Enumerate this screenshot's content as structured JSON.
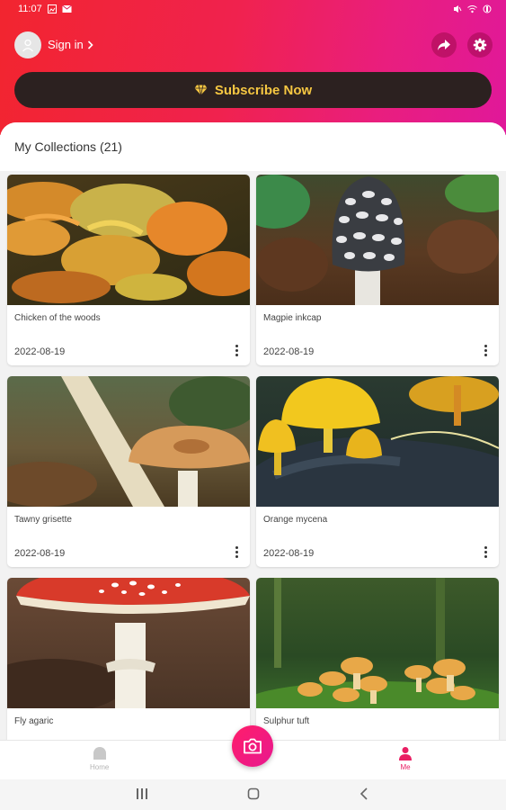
{
  "status_bar": {
    "time": "11:07"
  },
  "header": {
    "sign_in_label": "Sign in",
    "subscribe_label": "Subscribe Now",
    "accent_color": "#f6c742"
  },
  "collections": {
    "title": "My Collections",
    "count": "(21)",
    "items": [
      {
        "name": "Chicken of the woods",
        "date": "2022-08-19"
      },
      {
        "name": "Magpie inkcap",
        "date": "2022-08-19"
      },
      {
        "name": "Tawny grisette",
        "date": "2022-08-19"
      },
      {
        "name": "Orange mycena",
        "date": "2022-08-19"
      },
      {
        "name": "Fly agaric",
        "date": ""
      },
      {
        "name": "Sulphur tuft",
        "date": ""
      }
    ]
  },
  "bottom_nav": {
    "home_label": "Home",
    "me_label": "Me",
    "active_color": "#e91e63"
  }
}
